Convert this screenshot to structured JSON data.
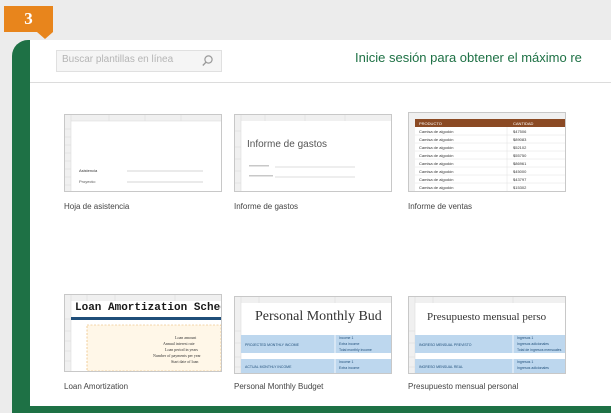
{
  "step": {
    "number": "3"
  },
  "search": {
    "placeholder": "Buscar plantillas en línea"
  },
  "signin": {
    "text": "Inicie sesión para obtener el máximo re"
  },
  "templates": [
    {
      "caption": "Hoja de asistencia",
      "labels": [
        "Asistencia",
        "Proyecto:"
      ]
    },
    {
      "caption": "Informe de gastos",
      "title": "Informe de gastos"
    },
    {
      "caption": "Informe de ventas",
      "header": [
        "PRODUCTO",
        "CANTIDAD"
      ],
      "rows": [
        [
          "Camisa de algodón",
          "$47506"
        ],
        [
          "Camisa de algodón",
          "$89083"
        ],
        [
          "Camisa de algodón",
          "$52102"
        ],
        [
          "Camisa de algodón",
          "$55750"
        ],
        [
          "Camisa de algodón",
          "$86961"
        ],
        [
          "Camisa de algodón",
          "$45000"
        ],
        [
          "Camisa de algodón",
          "$43797"
        ],
        [
          "Camisa de algodón",
          "$15302"
        ]
      ]
    },
    {
      "caption": "Loan Amortization",
      "title": "Loan Amortization Sched",
      "lines": [
        "Loan amount",
        "Annual interest rate",
        "Loan period in years",
        "Number of payments per year",
        "Start date of loan"
      ]
    },
    {
      "caption": "Personal Monthly Budget",
      "title": "Personal Monthly Bud",
      "rows": [
        "PROJECTED MONTHLY INCOME",
        "ACTUAL MONTHLY INCOME"
      ],
      "cells": [
        "Income 1",
        "Extra income",
        "Total monthly income",
        "Income 1",
        "Extra income"
      ]
    },
    {
      "caption": "Presupuesto mensual personal",
      "title": "Presupuesto mensual perso",
      "rows": [
        "INGRESO MENSUAL PREVISTO",
        "INGRESO MENSUAL REAL"
      ],
      "cells": [
        "Ingresos 1",
        "Ingresos adicionales",
        "Total de ingresos mensuales",
        "Ingresos 1",
        "Ingresos adicionales"
      ]
    }
  ],
  "colors": {
    "excel_green": "#1e7145",
    "badge_orange": "#e8851c",
    "header_brown": "#8b4a24",
    "budget_blue": "#bdd7ee",
    "loan_teal": "#1f4e79"
  }
}
